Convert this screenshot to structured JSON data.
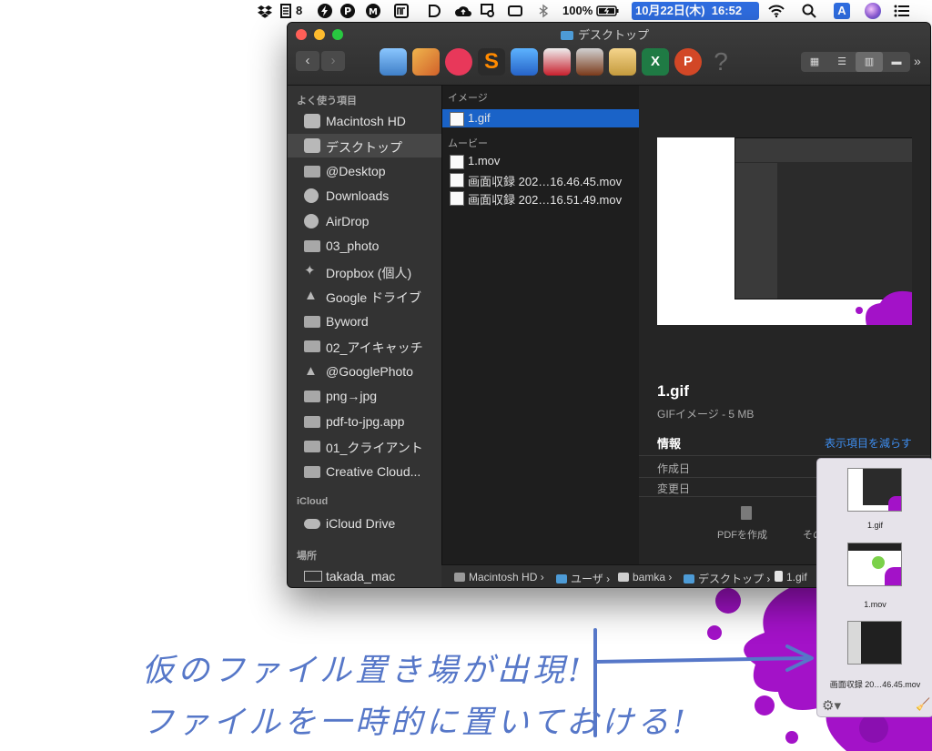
{
  "menubar": {
    "dropbox_count": "8",
    "battery": "100%",
    "datetime": "10月22日(木)  16:52",
    "input_source": "A"
  },
  "window": {
    "title": "デスクトップ",
    "back": "‹",
    "forward": "›"
  },
  "sidebar": {
    "favorites_header": "よく使う項目",
    "favorites": [
      {
        "label": "Macintosh HD",
        "icon": "disk-icon"
      },
      {
        "label": "デスクトップ",
        "icon": "desktop-icon"
      },
      {
        "label": "@Desktop",
        "icon": "folder-icon"
      },
      {
        "label": "Downloads",
        "icon": "download-icon"
      },
      {
        "label": "AirDrop",
        "icon": "airdrop-icon"
      },
      {
        "label": "03_photo",
        "icon": "folder-icon"
      },
      {
        "label": "Dropbox (個人)",
        "icon": "dropbox-icon"
      },
      {
        "label": "Google ドライブ",
        "icon": "drive-icon"
      },
      {
        "label": "Byword",
        "icon": "folder-icon"
      },
      {
        "label": "02_アイキャッチ",
        "icon": "folder-icon"
      },
      {
        "label": "@GooglePhoto",
        "icon": "drive-icon"
      },
      {
        "label": "png→jpg",
        "icon": "folder-icon"
      },
      {
        "label": "pdf-to-jpg.app",
        "icon": "folder-icon"
      },
      {
        "label": "01_クライアント",
        "icon": "folder-icon"
      },
      {
        "label": "Creative Cloud...",
        "icon": "folder-icon"
      }
    ],
    "icloud_header": "iCloud",
    "icloud_drive": "iCloud Drive",
    "places_header": "場所",
    "place_mac": "takada_mac"
  },
  "column": {
    "image_header": "イメージ",
    "image_items": [
      "1.gif"
    ],
    "movie_header": "ムービー",
    "movie_items": [
      "1.mov",
      "画面収録 202…16.46.45.mov",
      "画面収録 202…16.51.49.mov"
    ]
  },
  "preview": {
    "name": "1.gif",
    "kind": "GIFイメージ - 5 MB",
    "info_label": "情報",
    "show_less": "表示項目を減らす",
    "created_label": "作成日",
    "modified_label": "変更日",
    "create_pdf": "PDFを作成",
    "other": "その"
  },
  "pathbar": [
    "Macintosh HD",
    "ユーザ",
    "bamka",
    "デスクトップ",
    "1.gif"
  ],
  "shelf": {
    "items": [
      "1.gif",
      "1.mov",
      "画面収録 20…46.45.mov"
    ]
  },
  "annotation": {
    "line1": "仮のファイル置き場が出現!",
    "line2": "ファイルを一時的に置いておける!"
  },
  "colors": {
    "selection": "#1a63c8",
    "splash": "#a312c8",
    "handwriting": "#5677c8"
  }
}
